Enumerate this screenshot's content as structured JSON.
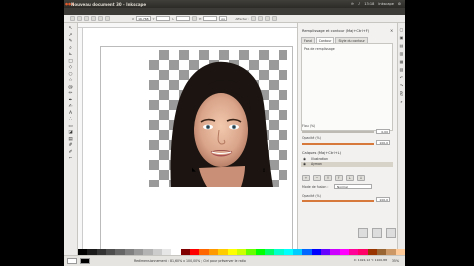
{
  "window": {
    "title": "Nouveau document 30 - Inkscape",
    "tray": {
      "lang": "fr",
      "time": "13:18",
      "user": "Inkscape"
    }
  },
  "toolcontrols": {
    "x_label": "X",
    "x_value": "16.768",
    "y_label": "Y",
    "y_value": "",
    "w_label": "L",
    "w_value": "",
    "h_label": "H",
    "h_value": "",
    "unit": "px",
    "affect_label": "Affecter :"
  },
  "toolbox": {
    "tools": [
      {
        "name": "selector-tool-icon",
        "glyph": "↖"
      },
      {
        "name": "node-tool-icon",
        "glyph": "↗"
      },
      {
        "name": "tweak-tool-icon",
        "glyph": "✎"
      },
      {
        "name": "zoom-tool-icon",
        "glyph": "⌕"
      },
      {
        "name": "measure-tool-icon",
        "glyph": "⊾"
      },
      {
        "name": "rect-tool-icon",
        "glyph": "□"
      },
      {
        "name": "3dbox-tool-icon",
        "glyph": "◇"
      },
      {
        "name": "ellipse-tool-icon",
        "glyph": "○"
      },
      {
        "name": "star-tool-icon",
        "glyph": "☆"
      },
      {
        "name": "spiral-tool-icon",
        "glyph": "@"
      },
      {
        "name": "pencil-tool-icon",
        "glyph": "✏"
      },
      {
        "name": "pen-tool-icon",
        "glyph": "✒"
      },
      {
        "name": "calligraphy-tool-icon",
        "glyph": "✍"
      },
      {
        "name": "text-tool-icon",
        "glyph": "A"
      },
      {
        "name": "spray-tool-icon",
        "glyph": "∴"
      },
      {
        "name": "eraser-tool-icon",
        "glyph": "▭"
      },
      {
        "name": "bucket-tool-icon",
        "glyph": "◪"
      },
      {
        "name": "gradient-tool-icon",
        "glyph": "▤"
      },
      {
        "name": "mesh-tool-icon",
        "glyph": "#"
      },
      {
        "name": "dropper-tool-icon",
        "glyph": "✐"
      },
      {
        "name": "connector-tool-icon",
        "glyph": "⌐"
      }
    ]
  },
  "fillstroke": {
    "title": "Remplissage et contour (Maj+Ctrl+F)",
    "tabs": [
      "Fond",
      "Contour",
      "Style du contour"
    ],
    "fill_label": "Pas de remplissage",
    "blur_label": "Flou (%)",
    "blur_value": "0,00",
    "opacity_label": "Opacité (%)",
    "opacity_value": "100,0"
  },
  "layers": {
    "title": "Calques (Maj+Ctrl+L)",
    "items": [
      {
        "label": "Illustration",
        "selected": false
      },
      {
        "label": "Ayman",
        "selected": true
      }
    ],
    "blend_label": "Mode de fusion :",
    "blend_value": "Normal",
    "opacity_label": "Opacité (%)",
    "opacity_value": "100,0"
  },
  "status": {
    "message": "Redimensionnement : 81,60% x 100,00% ; Ctrl pour préserver le ratio",
    "coords_x": "X: 1022,12",
    "coords_y": "Y: 1100,88",
    "zoom": "35%"
  },
  "palette": [
    "#000000",
    "#1a1a1a",
    "#333333",
    "#4d4d4d",
    "#666666",
    "#808080",
    "#999999",
    "#b3b3b3",
    "#cccccc",
    "#e6e6e6",
    "#ffffff",
    "#800000",
    "#ff0000",
    "#ff6600",
    "#ff9900",
    "#ffcc00",
    "#ffff00",
    "#ccff00",
    "#66ff00",
    "#00ff00",
    "#00ff66",
    "#00ffcc",
    "#00ffff",
    "#00ccff",
    "#0066ff",
    "#0000ff",
    "#6600ff",
    "#cc00ff",
    "#ff00ff",
    "#ff0099",
    "#ff0066",
    "#993300",
    "#996633",
    "#cc9966",
    "#ffcc99"
  ]
}
